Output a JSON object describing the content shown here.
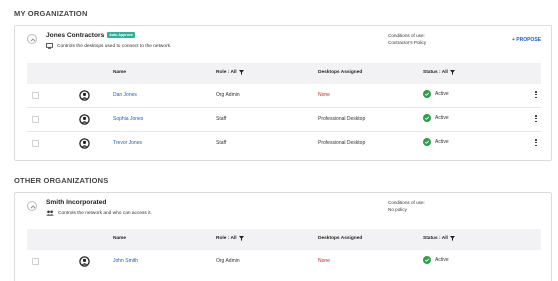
{
  "sections": {
    "my_org_title": "MY ORGANIZATION",
    "other_orgs_title": "OTHER ORGANIZATIONS"
  },
  "columns": {
    "name": "Name",
    "role": "Role : All",
    "desktops": "Desktops Assigned",
    "status": "Status : All"
  },
  "my_org": {
    "name": "Jones Contractors",
    "badge": "Auto Approve",
    "description": "Controls the desktops used to connect to the network.",
    "conditions_label": "Conditions of use:",
    "conditions_value": "Contractor's Policy",
    "propose_label": "+ PROPOSE",
    "rows": [
      {
        "name": "Dan Jones",
        "role": "Org Admin",
        "desktops": "None",
        "status": "Active"
      },
      {
        "name": "Sophia Jones",
        "role": "Staff",
        "desktops": "Professional Desktop",
        "status": "Active"
      },
      {
        "name": "Trevor Jones",
        "role": "Staff",
        "desktops": "Professional Desktop",
        "status": "Active"
      }
    ]
  },
  "other_org": {
    "name": "Smith Incorporated",
    "description": "Controls the network and who can access it.",
    "conditions_label": "Conditions of use:",
    "conditions_value": "No policy",
    "rows": [
      {
        "name": "John Smith",
        "role": "Org Admin",
        "desktops": "None",
        "status": "Active"
      }
    ]
  },
  "colors": {
    "accent": "#1a5fc7",
    "badge": "#2bb39a",
    "active": "#2e9e4a",
    "none": "#c0282d"
  }
}
